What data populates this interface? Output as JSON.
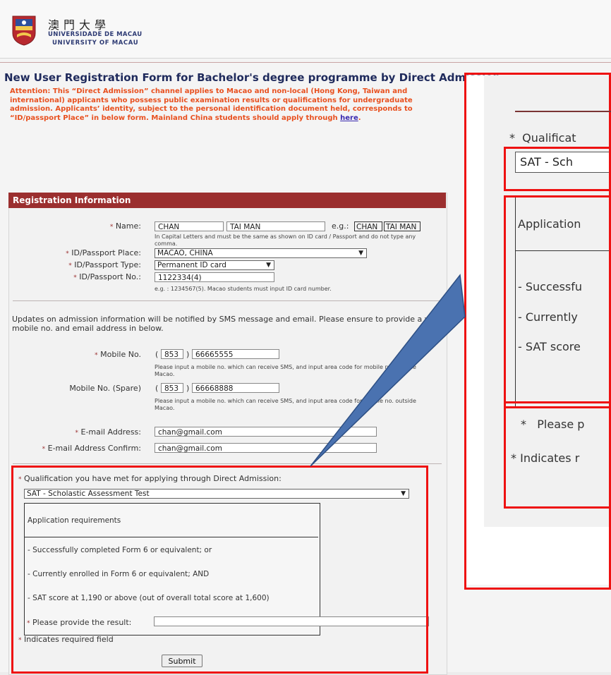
{
  "header": {
    "name_chinese": "澳門大學",
    "name_portuguese": "UNIVERSIDADE DE MACAU",
    "name_english": "UNIVERSITY OF MACAU"
  },
  "page_title": "New User Registration Form for Bachelor's degree programme by Direct Admission",
  "attention": {
    "text": "Attention: This “Direct Admission” channel applies to Macao and non-local (Hong Kong, Taiwan and international) applicants who possess public examination results or qualifications for undergraduate admission. Applicants’ identity, subject to the personal identification document held, corresponds to “ID/passport Place” in below form. Mainland China students should apply through ",
    "link": "here",
    "end": "."
  },
  "section_title": "Registration Information",
  "required_marker": "*",
  "form": {
    "name": {
      "label": "Name:",
      "surname": "CHAN",
      "given": "TAI MAN",
      "example_label": "e.g.:",
      "example_surname": "CHAN",
      "example_given": "TAI MAN",
      "note": "In Capital Letters and must be the same as shown on ID card / Passport and do not type any comma."
    },
    "id_place": {
      "label": "ID/Passport Place:",
      "value": "MACAO, CHINA"
    },
    "id_type": {
      "label": "ID/Passport Type:",
      "value": "Permanent ID card"
    },
    "id_no": {
      "label": "ID/Passport No.:",
      "value": "1122334(4)",
      "note": "e.g. : 1234567(5). Macao students must input ID card number."
    },
    "updates_note": "Updates on admission information will be notified by SMS message and email. Please ensure to provide a valid mobile no. and email address in below.",
    "mobile": {
      "label": "Mobile No.",
      "area": "853",
      "number": "66665555",
      "note": "Please input a mobile no. which can receive SMS, and input area code for mobile no. outside Macao."
    },
    "mobile_spare": {
      "label": "Mobile No. (Spare)",
      "area": "853",
      "number": "66668888",
      "note": "Please input a mobile no. which can receive SMS, and input area code for mobile no. outside Macao."
    },
    "email": {
      "label": "E-mail Address:",
      "value": "chan@gmail.com"
    },
    "email_confirm": {
      "label": "E-mail Address Confirm:",
      "value": "chan@gmail.com"
    },
    "open_paren": "(",
    "close_paren": ")"
  },
  "qualification": {
    "label": "Qualification you have met for applying through Direct Admission:",
    "value": "SAT - Scholastic Assessment Test",
    "requirements_title": "Application requirements",
    "requirements": [
      "- Successfully completed Form 6 or equivalent; or",
      "- Currently enrolled in Form 6 or equivalent; AND",
      "- SAT score at 1,190 or above (out of overall total score at 1,600)"
    ],
    "result_label": "Please provide the result:",
    "result_value": "",
    "required_note": "Indicates required field",
    "submit_label": "Submit"
  },
  "zoom": {
    "qualification_label": "Qualificat",
    "select_value": "SAT - Sch",
    "requirements_title": "Application",
    "req1": "- Successfu",
    "req2": "- Currently",
    "req3": "- SAT score",
    "result_label": "Please p",
    "required_note": "Indicates r"
  },
  "colors": {
    "section_header": "#9b2f2f",
    "attention_text": "#e8501f",
    "title_text": "#1f2a5c",
    "highlight_box": "#ee1111",
    "callout_arrow": "#4a72b0"
  }
}
